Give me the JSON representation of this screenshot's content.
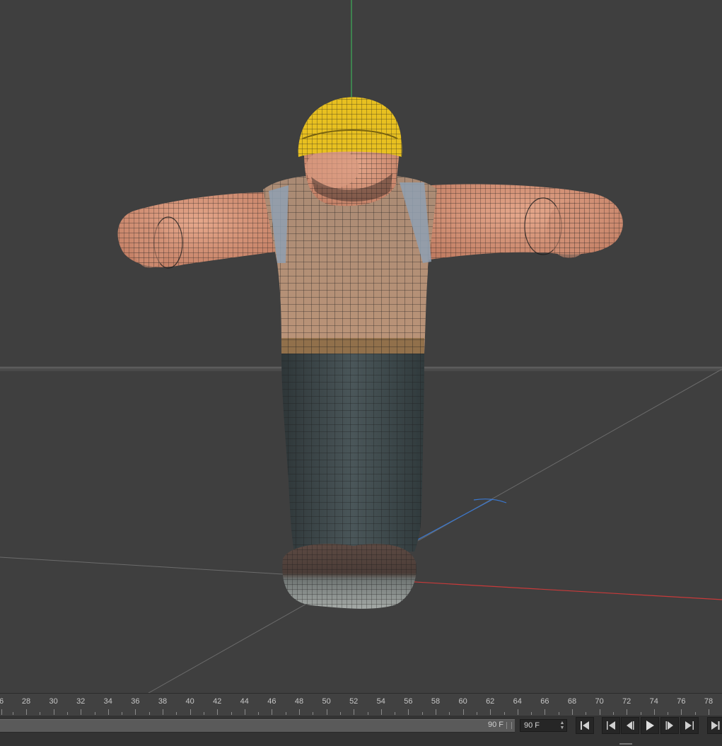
{
  "viewport": {
    "scene": "character-mesh-t-pose",
    "colors": {
      "background": "#3f3f3f",
      "y_axis": "#3fae5a",
      "x_axis": "#c83a3a",
      "z_axis": "#3a78d0",
      "helmet": "#e8c020",
      "skin": "#d8957a",
      "shirt": "#b08a6f",
      "pants": "#3f4a4d",
      "wire": "#1c1c1c"
    }
  },
  "timeline": {
    "ticks": [
      "6",
      "28",
      "30",
      "32",
      "34",
      "36",
      "38",
      "40",
      "42",
      "44",
      "46",
      "48",
      "50",
      "52",
      "54",
      "56",
      "58",
      "60",
      "62",
      "64",
      "66",
      "68",
      "70",
      "72",
      "74",
      "76",
      "78"
    ]
  },
  "transport": {
    "end_frame_label": "90 F",
    "frame_field_value": "90 F",
    "buttons": [
      {
        "name": "go-to-start-button",
        "icon": "skip-to-start-icon"
      },
      {
        "name": "previous-key-button",
        "icon": "previous-key-icon"
      },
      {
        "name": "step-back-button",
        "icon": "step-back-icon"
      },
      {
        "name": "play-button",
        "icon": "play-icon"
      },
      {
        "name": "step-forward-button",
        "icon": "step-forward-icon"
      },
      {
        "name": "next-key-button",
        "icon": "next-key-icon"
      },
      {
        "name": "go-to-end-button",
        "icon": "skip-to-end-icon"
      }
    ]
  }
}
